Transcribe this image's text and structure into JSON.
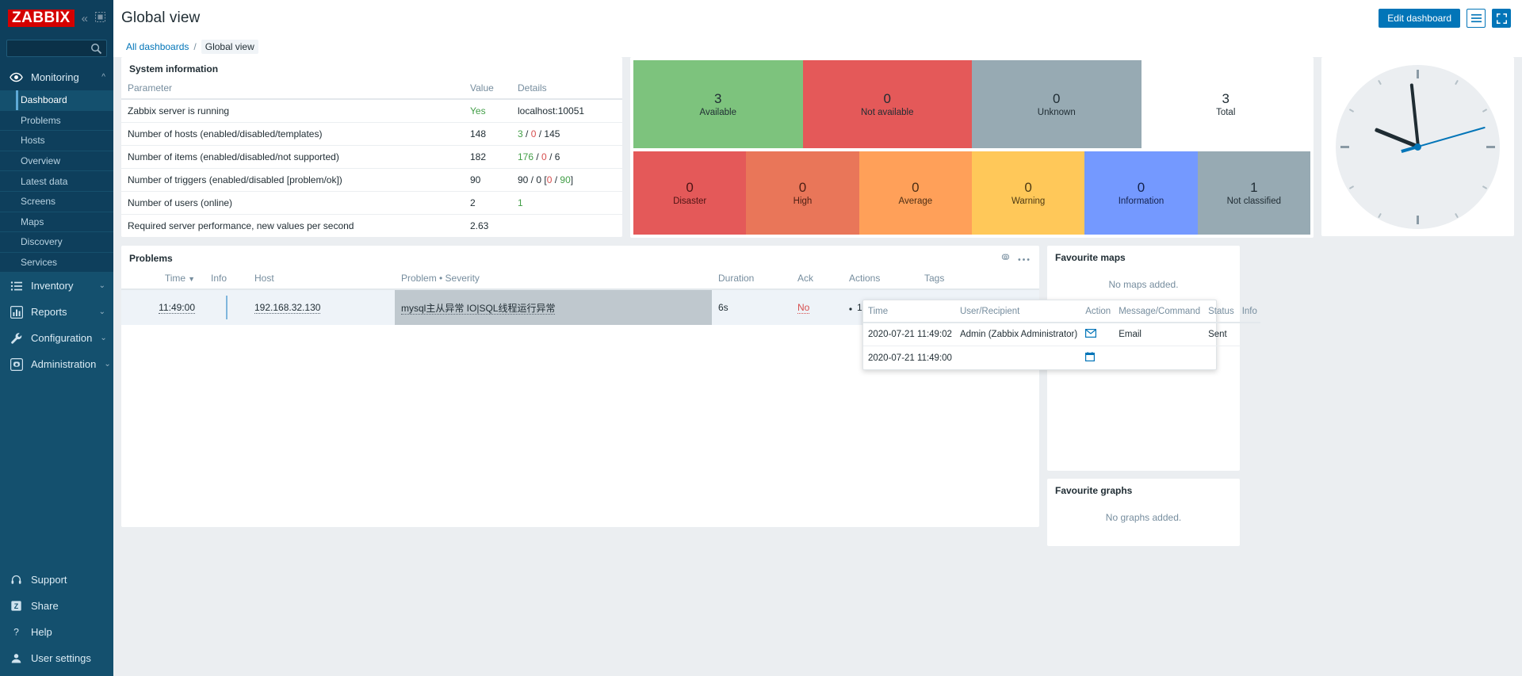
{
  "sidebar": {
    "logo_text": "ZABBIX",
    "collapse_icon": "chevron-double-left-icon",
    "compact_icon": "collapse-view-icon",
    "search": {
      "value": "",
      "placeholder": "",
      "icon": "search-icon"
    },
    "groups": [
      {
        "label": "Monitoring",
        "icon": "eye-icon",
        "expanded": true,
        "items": [
          {
            "label": "Dashboard",
            "selected": true
          },
          {
            "label": "Problems",
            "selected": false
          },
          {
            "label": "Hosts",
            "selected": false
          },
          {
            "label": "Overview",
            "selected": false
          },
          {
            "label": "Latest data",
            "selected": false
          },
          {
            "label": "Screens",
            "selected": false
          },
          {
            "label": "Maps",
            "selected": false
          },
          {
            "label": "Discovery",
            "selected": false
          },
          {
            "label": "Services",
            "selected": false
          }
        ]
      },
      {
        "label": "Inventory",
        "icon": "list-icon",
        "expanded": false,
        "items": []
      },
      {
        "label": "Reports",
        "icon": "bar-chart-icon",
        "expanded": false,
        "items": []
      },
      {
        "label": "Configuration",
        "icon": "wrench-icon",
        "expanded": false,
        "items": []
      },
      {
        "label": "Administration",
        "icon": "gear-icon",
        "expanded": false,
        "items": []
      }
    ],
    "bottom_items": [
      {
        "label": "Support",
        "icon": "headset-icon"
      },
      {
        "label": "Share",
        "icon": "share-z-icon"
      },
      {
        "label": "Help",
        "icon": "question-icon"
      },
      {
        "label": "User settings",
        "icon": "user-icon"
      }
    ]
  },
  "header": {
    "title": "Global view",
    "edit_dashboard_label": "Edit dashboard",
    "menu_icon": "hamburger-menu-icon",
    "fullscreen_icon": "fullscreen-icon"
  },
  "breadcrumb": {
    "all_dashboards": "All dashboards",
    "separator": "/",
    "current": "Global view"
  },
  "system_information": {
    "title": "System information",
    "columns": [
      "Parameter",
      "Value",
      "Details"
    ],
    "rows": [
      {
        "parameter": "Zabbix server is running",
        "value": "Yes",
        "value_color": "green",
        "details": "localhost:10051",
        "details_parts": null
      },
      {
        "parameter": "Number of hosts (enabled/disabled/templates)",
        "value": "148",
        "value_color": "gray",
        "details": "3 / 0 / 145",
        "details_parts": [
          {
            "t": "3",
            "c": "green"
          },
          {
            "t": " / ",
            "c": "gray"
          },
          {
            "t": "0",
            "c": "red"
          },
          {
            "t": " / 145",
            "c": "gray"
          }
        ]
      },
      {
        "parameter": "Number of items (enabled/disabled/not supported)",
        "value": "182",
        "value_color": "gray",
        "details": "176 / 0 / 6",
        "details_parts": [
          {
            "t": "176",
            "c": "green"
          },
          {
            "t": " / ",
            "c": "gray"
          },
          {
            "t": "0",
            "c": "red"
          },
          {
            "t": " / 6",
            "c": "gray"
          }
        ]
      },
      {
        "parameter": "Number of triggers (enabled/disabled [problem/ok])",
        "value": "90",
        "value_color": "gray",
        "details": "90 / 0 [0 / 90]",
        "details_parts": [
          {
            "t": "90 / 0 [",
            "c": "gray"
          },
          {
            "t": "0",
            "c": "red"
          },
          {
            "t": " / ",
            "c": "gray"
          },
          {
            "t": "90",
            "c": "green"
          },
          {
            "t": "]",
            "c": "gray"
          }
        ]
      },
      {
        "parameter": "Number of users (online)",
        "value": "2",
        "value_color": "gray",
        "details": "1",
        "details_parts": [
          {
            "t": "1",
            "c": "green"
          }
        ]
      },
      {
        "parameter": "Required server performance, new values per second",
        "value": "2.63",
        "value_color": "gray",
        "details": "",
        "details_parts": null
      }
    ]
  },
  "host_availability": {
    "tiles": [
      {
        "count": "3",
        "label": "Available",
        "color": "#7dc37d",
        "text_color": "#1f2c33"
      },
      {
        "count": "0",
        "label": "Not available",
        "color": "#e45959",
        "text_color": "#1f2c33"
      },
      {
        "count": "0",
        "label": "Unknown",
        "color": "#97aab3",
        "text_color": "#1f2c33"
      },
      {
        "count": "3",
        "label": "Total",
        "color": "#ffffff",
        "text_color": "#1f2c33"
      }
    ]
  },
  "problems_by_severity": {
    "tiles": [
      {
        "count": "0",
        "label": "Disaster",
        "color": "#e45959",
        "text_color": "#4d1414"
      },
      {
        "count": "0",
        "label": "High",
        "color": "#e97659",
        "text_color": "#4d1f14"
      },
      {
        "count": "0",
        "label": "Average",
        "color": "#ffa059",
        "text_color": "#4d2e14"
      },
      {
        "count": "0",
        "label": "Warning",
        "color": "#ffc859",
        "text_color": "#4d3a14"
      },
      {
        "count": "0",
        "label": "Information",
        "color": "#7499ff",
        "text_color": "#14224d"
      },
      {
        "count": "1",
        "label": "Not classified",
        "color": "#97aab3",
        "text_color": "#1f2c33"
      }
    ]
  },
  "clock": {
    "hour_angle": 292,
    "minute_angle": 354,
    "second_angle": 74
  },
  "problems": {
    "title": "Problems",
    "gear_icon": "gear-icon",
    "more_icon": "ellipsis-icon",
    "columns": [
      "Time",
      "Info",
      "Host",
      "Problem • Severity",
      "Duration",
      "Ack",
      "Actions",
      "Tags"
    ],
    "sort_indicator": "▼",
    "rows": [
      {
        "time": "11:49:00",
        "info": "",
        "host": "192.168.32.130",
        "problem": "mysql主从异常 IO|SQL线程运行异常",
        "duration": "6s",
        "ack": "No",
        "actions": "1",
        "tags": ""
      }
    ]
  },
  "actions_popup": {
    "columns": [
      "Time",
      "User/Recipient",
      "Action",
      "Message/Command",
      "Status",
      "Info"
    ],
    "rows": [
      {
        "time": "2020-07-21 11:49:02",
        "user": "Admin (Zabbix Administrator)",
        "action_icon": "email-icon",
        "message": "Email",
        "status": "Sent",
        "info": ""
      },
      {
        "time": "2020-07-21 11:49:00",
        "user": "",
        "action_icon": "calendar-icon",
        "message": "",
        "status": "",
        "info": ""
      }
    ]
  },
  "favourite_maps": {
    "title": "Favourite maps",
    "empty_text": "No maps added."
  },
  "favourite_graphs": {
    "title": "Favourite graphs",
    "empty_text": "No graphs added."
  },
  "colors": {
    "sidebar_bg": "#14506e",
    "sidebar_dark": "#0e3f5c",
    "brand_red": "#d40000",
    "accent_blue": "#0275b8",
    "dash_bg": "#ebeef1"
  }
}
